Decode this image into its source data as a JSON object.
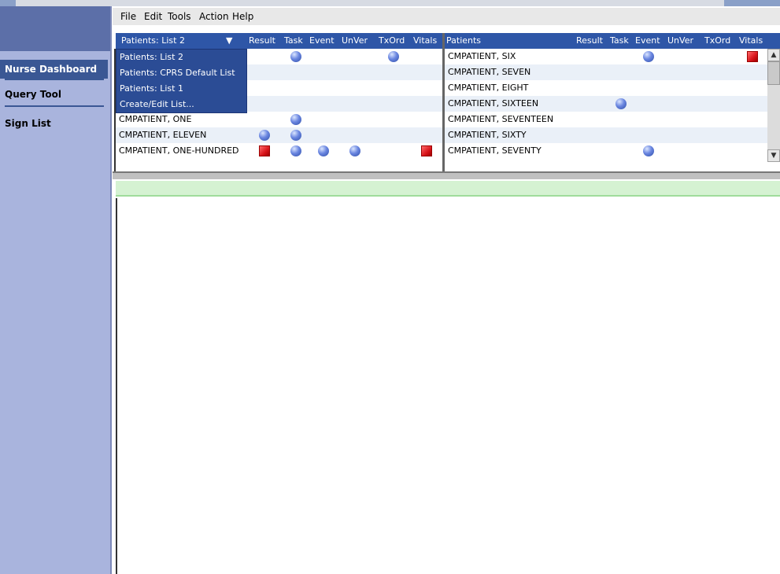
{
  "menubar": {
    "items": [
      {
        "label": "File",
        "name": "menu-file"
      },
      {
        "label": "Edit",
        "name": "menu-edit"
      },
      {
        "label": "Tools",
        "name": "menu-tools"
      },
      {
        "label": "Action",
        "name": "menu-action"
      },
      {
        "label": "Help",
        "name": "menu-help"
      }
    ]
  },
  "nav": {
    "items": [
      {
        "label": "Nurse Dashboard",
        "active": true
      },
      {
        "label": "Query Tool",
        "active": false
      },
      {
        "label": "Sign List",
        "active": false
      }
    ]
  },
  "left_panel": {
    "selector_label": "Patients: List 2",
    "columns": [
      "Result",
      "Task",
      "Event",
      "UnVer",
      "TxOrd",
      "Vitals"
    ],
    "rows": [
      {
        "name": "",
        "result": "",
        "task": "ball",
        "event": "",
        "unver": "",
        "txord": "ball",
        "vitals": ""
      },
      {
        "name": "",
        "result": "",
        "task": "",
        "event": "",
        "unver": "",
        "txord": "",
        "vitals": ""
      },
      {
        "name": "",
        "result": "",
        "task": "",
        "event": "",
        "unver": "",
        "txord": "",
        "vitals": ""
      },
      {
        "name": "",
        "result": "",
        "task": "",
        "event": "",
        "unver": "",
        "txord": "",
        "vitals": ""
      },
      {
        "name": "CMPATIENT, ONE",
        "result": "",
        "task": "ball",
        "event": "",
        "unver": "",
        "txord": "",
        "vitals": ""
      },
      {
        "name": "CMPATIENT, ELEVEN",
        "result": "ball",
        "task": "ball",
        "event": "",
        "unver": "",
        "txord": "",
        "vitals": ""
      },
      {
        "name": "CMPATIENT, ONE-HUNDRED",
        "result": "square",
        "task": "ball",
        "event": "ball",
        "unver": "ball",
        "txord": "",
        "vitals": "square"
      }
    ],
    "dropdown_options": [
      "Patients: List 2",
      "Patients: CPRS Default List",
      "Patients: List 1",
      "Create/Edit List..."
    ]
  },
  "right_panel": {
    "title": "Patients",
    "columns": [
      "Result",
      "Task",
      "Event",
      "UnVer",
      "TxOrd",
      "Vitals"
    ],
    "rows": [
      {
        "name": "CMPATIENT, SIX",
        "result": "",
        "task": "",
        "event": "ball",
        "unver": "",
        "txord": "",
        "vitals": "square"
      },
      {
        "name": "CMPATIENT, SEVEN",
        "result": "",
        "task": "",
        "event": "",
        "unver": "",
        "txord": "",
        "vitals": ""
      },
      {
        "name": "CMPATIENT, EIGHT",
        "result": "",
        "task": "",
        "event": "",
        "unver": "",
        "txord": "",
        "vitals": ""
      },
      {
        "name": "CMPATIENT, SIXTEEN",
        "result": "",
        "task": "ball",
        "event": "",
        "unver": "",
        "txord": "",
        "vitals": ""
      },
      {
        "name": "CMPATIENT, SEVENTEEN",
        "result": "",
        "task": "",
        "event": "",
        "unver": "",
        "txord": "",
        "vitals": ""
      },
      {
        "name": "CMPATIENT, SIXTY",
        "result": "",
        "task": "",
        "event": "",
        "unver": "",
        "txord": "",
        "vitals": ""
      },
      {
        "name": "CMPATIENT, SEVENTY",
        "result": "",
        "task": "",
        "event": "ball",
        "unver": "",
        "txord": "",
        "vitals": ""
      }
    ]
  },
  "colors": {
    "header_blue": "#2e56a7",
    "nav_bg": "#a9b4dd",
    "accent": "#3a5794",
    "status_green": "#d5f2d2"
  }
}
